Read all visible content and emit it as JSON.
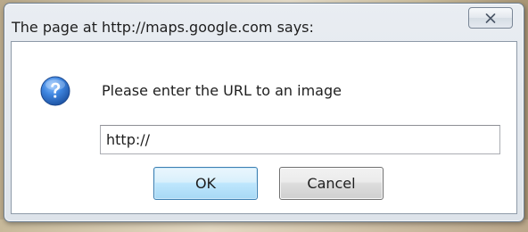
{
  "dialog": {
    "title": "The page at http://maps.google.com says:",
    "close_icon": "close-icon",
    "message_icon": "question-icon",
    "message": "Please enter the URL to an image",
    "input": {
      "value": "http://",
      "placeholder": ""
    },
    "buttons": {
      "ok_label": "OK",
      "cancel_label": "Cancel"
    }
  },
  "colors": {
    "icon_blue": "#2f6fc1",
    "ok_border": "#3c7fb1",
    "window_border": "#6f7f8f"
  }
}
